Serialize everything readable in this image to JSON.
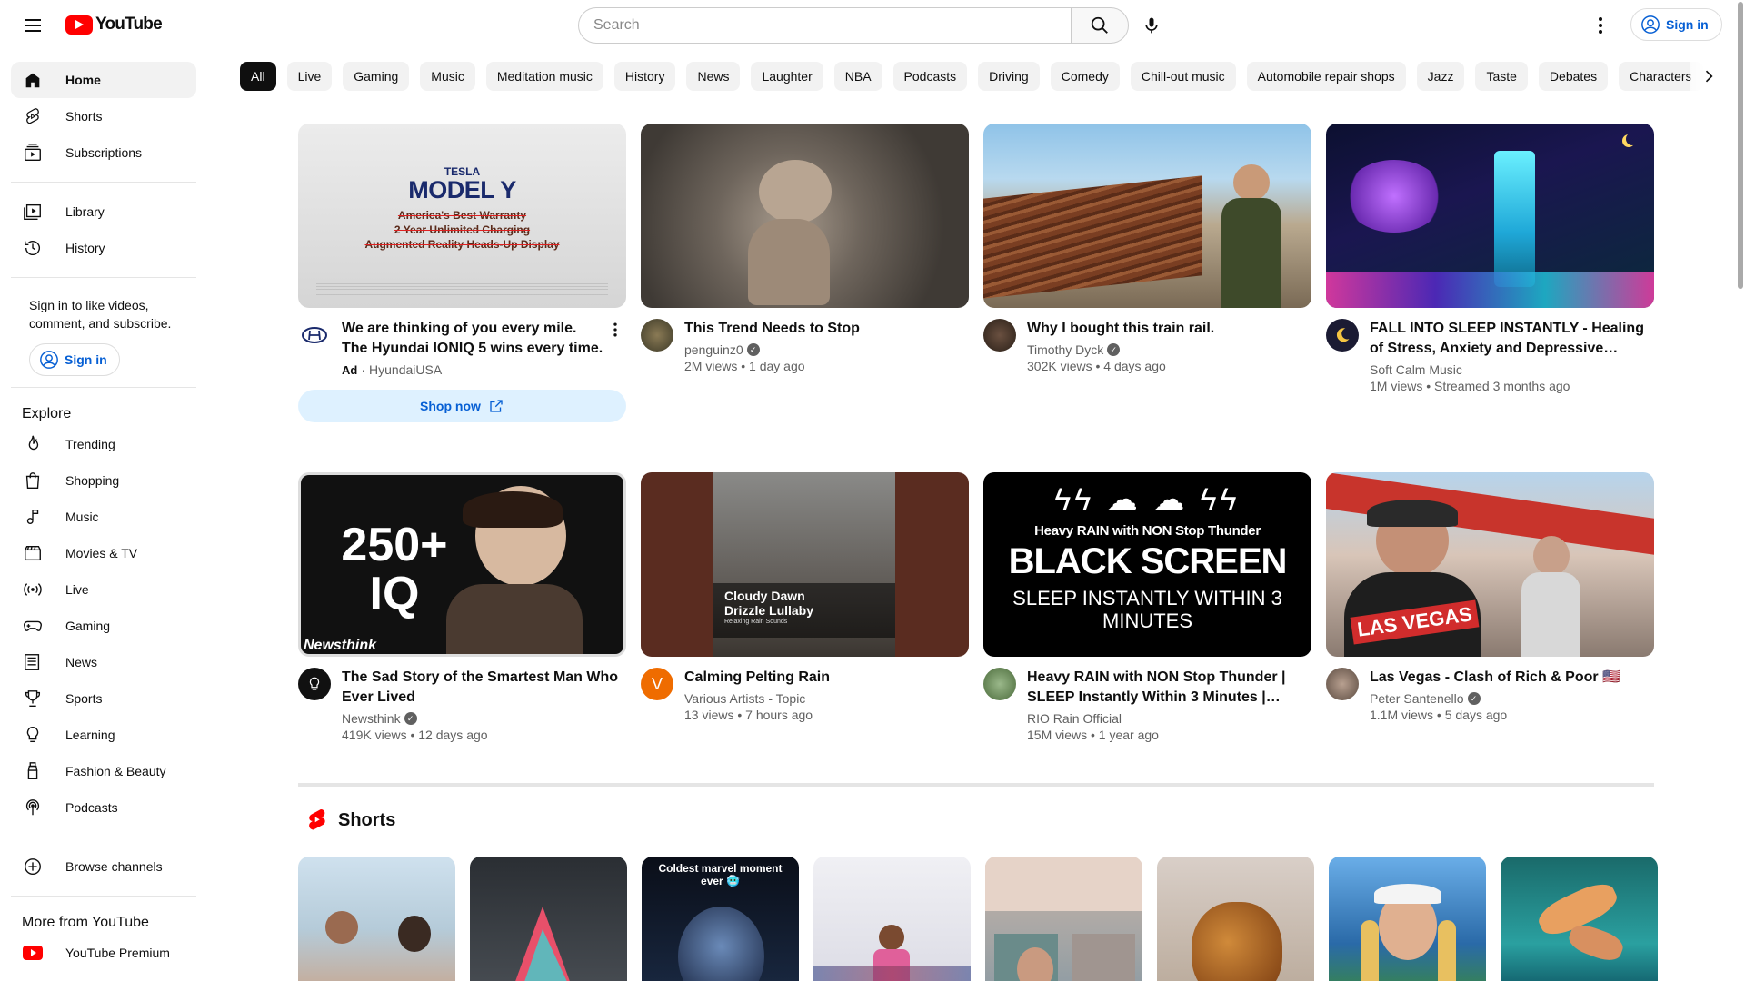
{
  "header": {
    "logo_text": "YouTube",
    "search_placeholder": "Search",
    "signin_label": "Sign in"
  },
  "sidebar": {
    "main": [
      {
        "label": "Home",
        "icon": "home-icon",
        "active": true
      },
      {
        "label": "Shorts",
        "icon": "shorts-icon"
      },
      {
        "label": "Subscriptions",
        "icon": "subscriptions-icon"
      }
    ],
    "library": [
      {
        "label": "Library",
        "icon": "library-icon"
      },
      {
        "label": "History",
        "icon": "history-icon"
      }
    ],
    "signin_prompt": "Sign in to like videos, comment, and subscribe.",
    "signin_label": "Sign in",
    "explore_heading": "Explore",
    "explore": [
      {
        "label": "Trending",
        "icon": "trending-icon"
      },
      {
        "label": "Shopping",
        "icon": "shopping-icon"
      },
      {
        "label": "Music",
        "icon": "music-icon"
      },
      {
        "label": "Movies & TV",
        "icon": "movies-icon"
      },
      {
        "label": "Live",
        "icon": "live-icon"
      },
      {
        "label": "Gaming",
        "icon": "gaming-icon"
      },
      {
        "label": "News",
        "icon": "news-icon"
      },
      {
        "label": "Sports",
        "icon": "sports-icon"
      },
      {
        "label": "Learning",
        "icon": "learning-icon"
      },
      {
        "label": "Fashion & Beauty",
        "icon": "fashion-icon"
      },
      {
        "label": "Podcasts",
        "icon": "podcasts-icon"
      }
    ],
    "browse_channels": "Browse channels",
    "more_heading": "More from YouTube",
    "premium": "YouTube Premium"
  },
  "chips": [
    "All",
    "Live",
    "Gaming",
    "Music",
    "Meditation music",
    "History",
    "News",
    "Laughter",
    "NBA",
    "Podcasts",
    "Driving",
    "Comedy",
    "Chill-out music",
    "Automobile repair shops",
    "Jazz",
    "Taste",
    "Debates",
    "Characters"
  ],
  "videos_row1": [
    {
      "title": "We are thinking of you every mile. The Hyundai IONIQ 5 wins every time.",
      "ad_label": "Ad",
      "channel": "HyundaiUSA",
      "stats": "",
      "cta": "Shop now",
      "thumb_text": {
        "brand": "TESLA",
        "model": "MODEL Y",
        "lines": [
          "America's Best Warranty",
          "2 Year Unlimited Charging",
          "Augmented Reality Heads-Up Display"
        ]
      }
    },
    {
      "title": "This Trend Needs to Stop",
      "channel": "penguinz0",
      "verified": true,
      "stats": "2M views • 1 day ago"
    },
    {
      "title": "Why I bought this train rail.",
      "channel": "Timothy Dyck",
      "verified": true,
      "stats": "302K views • 4 days ago"
    },
    {
      "title": "FALL INTO SLEEP INSTANTLY - Healing of Stress, Anxiety and Depressive…",
      "channel": "Soft Calm Music",
      "verified": false,
      "stats": "1M views • Streamed 3 months ago"
    }
  ],
  "videos_row2": [
    {
      "title": "The Sad Story of the Smartest Man Who Ever Lived",
      "channel": "Newsthink",
      "verified": true,
      "stats": "419K views • 12 days ago",
      "thumb_text": {
        "big": "250+ IQ",
        "brand": "Newsthink"
      }
    },
    {
      "title": "Calming Pelting Rain",
      "channel": "Various Artists - Topic",
      "verified": false,
      "stats": "13 views • 7 hours ago",
      "avatar_letter": "V",
      "thumb_text": {
        "line1": "Cloudy Dawn",
        "line2": "Drizzle Lullaby",
        "line3": "Relaxing Rain Sounds"
      }
    },
    {
      "title": "Heavy RAIN with NON Stop Thunder | SLEEP Instantly Within 3 Minutes |…",
      "channel": "RIO Rain Official",
      "verified": false,
      "stats": "15M views • 1 year ago",
      "thumb_text": {
        "top": "Heavy RAIN with NON Stop Thunder",
        "big": "BLACK SCREEN",
        "bottom": "SLEEP INSTANTLY WITHIN 3 MINUTES"
      }
    },
    {
      "title": "Las Vegas - Clash of Rich & Poor 🇺🇸",
      "channel": "Peter Santenello",
      "verified": true,
      "stats": "1.1M views • 5 days ago",
      "thumb_text": {
        "label": "LAS VEGAS"
      }
    }
  ],
  "shorts": {
    "heading": "Shorts",
    "items": [
      {
        "caption": ""
      },
      {
        "caption": ""
      },
      {
        "caption": "Coldest marvel moment ever 🥶"
      },
      {
        "caption": ""
      },
      {
        "caption": ""
      },
      {
        "caption": ""
      },
      {
        "caption": ""
      },
      {
        "caption": ""
      }
    ]
  },
  "colors": {
    "brand_red": "#ff0000",
    "link_blue": "#065fd4",
    "chip_bg": "#f2f2f2",
    "text_secondary": "#606060"
  }
}
